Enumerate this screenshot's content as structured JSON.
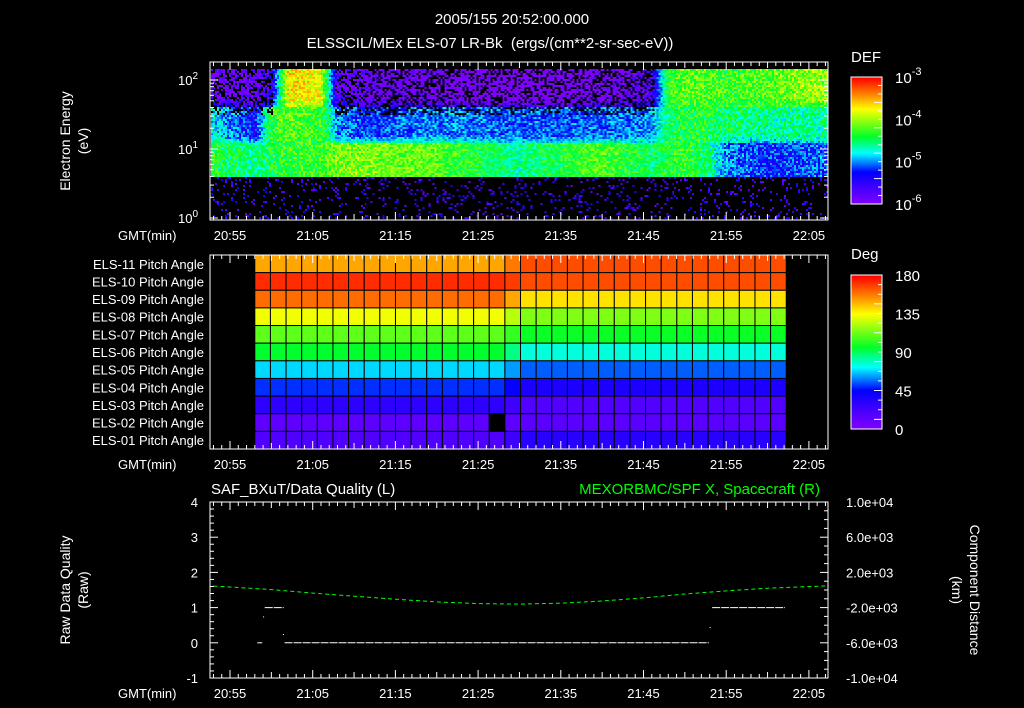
{
  "header": {
    "datetime": "2005/155 20:52:00.000",
    "title": "ELSSCIL/MEx ELS-07 LR-Bk  (ergs/(cm**2-sr-sec-eV))"
  },
  "time_axis": {
    "label": "GMT(min)",
    "ticks": [
      "20:55",
      "21:05",
      "21:15",
      "21:25",
      "21:35",
      "21:45",
      "21:55",
      "22:05"
    ]
  },
  "colors": {
    "background": "#000000",
    "axis": "#ffffff",
    "right_series": "#00ff00"
  },
  "chart_data": [
    {
      "type": "heatmap",
      "name": "electron-spectrogram",
      "ylabel": "Electron Energy",
      "yunit": "(eV)",
      "yscale": "log",
      "ylim": [
        1,
        180
      ],
      "y_ticks": [
        {
          "base": "10",
          "exp": "2",
          "value": 100
        },
        {
          "base": "10",
          "exp": "1",
          "value": 10
        },
        {
          "base": "10",
          "exp": "0",
          "value": 1
        }
      ],
      "colorbar": {
        "title": "DEF",
        "scale": "log",
        "range_log10": [
          -6,
          -3
        ],
        "labels": [
          {
            "base": "10",
            "exp": "-3"
          },
          {
            "base": "10",
            "exp": "-4"
          },
          {
            "base": "10",
            "exp": "-5"
          },
          {
            "base": "10",
            "exp": "-6"
          }
        ]
      },
      "noise_floor_eV": 3.8,
      "coarse_log10_def": {
        "times": [
          "20:53",
          "20:58",
          "21:00",
          "21:02",
          "21:06",
          "21:08",
          "21:12",
          "21:20",
          "21:30",
          "21:40",
          "21:46",
          "21:48",
          "21:50",
          "21:53",
          "21:55",
          "22:00",
          "22:07"
        ],
        "band_40_150eV": [
          -5.9,
          -5.9,
          -5.6,
          -3.7,
          -3.8,
          -5.8,
          -5.9,
          -6.0,
          -6.2,
          -6.0,
          -5.8,
          -4.3,
          -4.2,
          -4.2,
          -4.3,
          -4.2,
          -4.0
        ],
        "band_12_40eV": [
          -4.8,
          -5.3,
          -4.3,
          -4.2,
          -4.3,
          -5.0,
          -5.2,
          -5.0,
          -5.1,
          -5.1,
          -5.0,
          -4.5,
          -4.4,
          -4.4,
          -4.5,
          -4.6,
          -4.6
        ],
        "band_4_12eV": [
          -4.4,
          -4.6,
          -4.4,
          -4.3,
          -4.3,
          -4.1,
          -4.1,
          -4.2,
          -4.6,
          -4.2,
          -4.5,
          -4.4,
          -4.3,
          -4.5,
          -5.0,
          -5.2,
          -5.1
        ]
      }
    },
    {
      "type": "heatmap",
      "name": "pitch-angle-panel",
      "rows": [
        "ELS-11 Pitch Angle",
        "ELS-10 Pitch Angle",
        "ELS-09 Pitch Angle",
        "ELS-08 Pitch Angle",
        "ELS-07 Pitch Angle",
        "ELS-06 Pitch Angle",
        "ELS-05 Pitch Angle",
        "ELS-04 Pitch Angle",
        "ELS-03 Pitch Angle",
        "ELS-02 Pitch Angle",
        "ELS-01 Pitch Angle"
      ],
      "start_time": "20:58",
      "column_minutes": 1.89,
      "columns": 34,
      "transition_column": 16,
      "values_before_deg": [
        150,
        172,
        160,
        133,
        110,
        95,
        68,
        50,
        30,
        13,
        18
      ],
      "values_after_deg": [
        166,
        166,
        140,
        115,
        97,
        76,
        55,
        36,
        17,
        14,
        32
      ],
      "missing_cells": [
        {
          "row": 9,
          "columns": [
            15
          ]
        }
      ],
      "colorbar": {
        "title": "Deg",
        "range": [
          0,
          180
        ],
        "labels": [
          "180",
          "135",
          "90",
          "45",
          "0"
        ]
      }
    },
    {
      "type": "line",
      "name": "data-quality-and-position",
      "left_title": "SAF_BXuT/Data Quality (L)",
      "right_title": "MEXORBMC/SPF X, Spacecraft (R)",
      "ylabel_left": "Raw Data Quality",
      "yunit_left": "(Raw)",
      "ylabel_right": "Component Distance",
      "yunit_right": "(km)",
      "ylim_left": [
        -1,
        4
      ],
      "left_ticks": [
        "4",
        "3",
        "2",
        "1",
        "0",
        "-1"
      ],
      "ylim_right": [
        -10000,
        10000
      ],
      "right_ticks": [
        "1.0e+04",
        "6.0e+03",
        "2.0e+03",
        "-2.0e+03",
        "-6.0e+03",
        "-1.0e+04"
      ],
      "quality_segments": [
        {
          "from": "20:58.3",
          "to": "20:58.9",
          "value": 0
        },
        {
          "from": "20:59.2",
          "to": "21:01.5",
          "value": 1
        },
        {
          "from": "21:01.6",
          "to": "21:52.9",
          "value": 0
        },
        {
          "from": "21:53.3",
          "to": "22:02.1",
          "value": 1
        }
      ],
      "quality_points": [
        {
          "t": "20:59",
          "v": 0.75
        },
        {
          "t": "21:01.4",
          "v": 0.25
        },
        {
          "t": "21:53",
          "v": 0.45
        }
      ],
      "spf_x_km": {
        "times": [
          "20:53",
          "21:00",
          "21:05",
          "21:10",
          "21:15",
          "21:20",
          "21:25",
          "21:30",
          "21:35",
          "21:40",
          "21:45",
          "21:50",
          "21:55",
          "22:00",
          "22:07.4"
        ],
        "values": [
          450,
          50,
          -350,
          -700,
          -1050,
          -1350,
          -1550,
          -1600,
          -1500,
          -1250,
          -900,
          -450,
          -100,
          200,
          480
        ]
      }
    }
  ]
}
